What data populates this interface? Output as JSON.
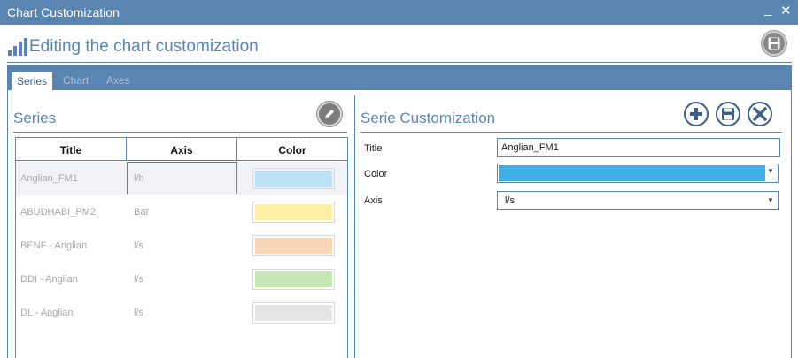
{
  "window": {
    "title": "Chart Customization",
    "minimize_glyph": "_",
    "close_glyph": "✕"
  },
  "header": {
    "heading": "Editing the chart customization",
    "icon": "bar-chart-icon",
    "save_icon": "save-icon"
  },
  "tabs": [
    {
      "label": "Series",
      "active": true
    },
    {
      "label": "Chart",
      "active": false
    },
    {
      "label": "Axes",
      "active": false
    }
  ],
  "series_panel": {
    "title": "Series",
    "edit_icon": "pencil-icon",
    "columns": [
      "Title",
      "Axis",
      "Color"
    ],
    "rows": [
      {
        "title": "Anglian_FM1",
        "axis": "l/h",
        "color": "#bde1f5",
        "selected": true
      },
      {
        "title": "ABUDHABI_PM2",
        "axis": "Bar",
        "color": "#fff0a6",
        "selected": false
      },
      {
        "title": "BENF - Anglian",
        "axis": "l/s",
        "color": "#f9d4b5",
        "selected": false
      },
      {
        "title": "DDI - Anglian",
        "axis": "l/s",
        "color": "#c6e6b3",
        "selected": false
      },
      {
        "title": "DL - Anglian",
        "axis": "l/s",
        "color": "#e6e6e6",
        "selected": false
      }
    ]
  },
  "customization_panel": {
    "title": "Serie Customization",
    "actions": [
      "add-icon",
      "save-icon",
      "cancel-icon"
    ],
    "fields": {
      "title_label": "Title",
      "title_value": "Anglian_FM1",
      "color_label": "Color",
      "color_value": "#3eb0e7",
      "axis_label": "Axis",
      "axis_value": "l/s"
    }
  },
  "colors": {
    "accent": "#5a85b3",
    "dark_accent": "#3f5f87"
  }
}
